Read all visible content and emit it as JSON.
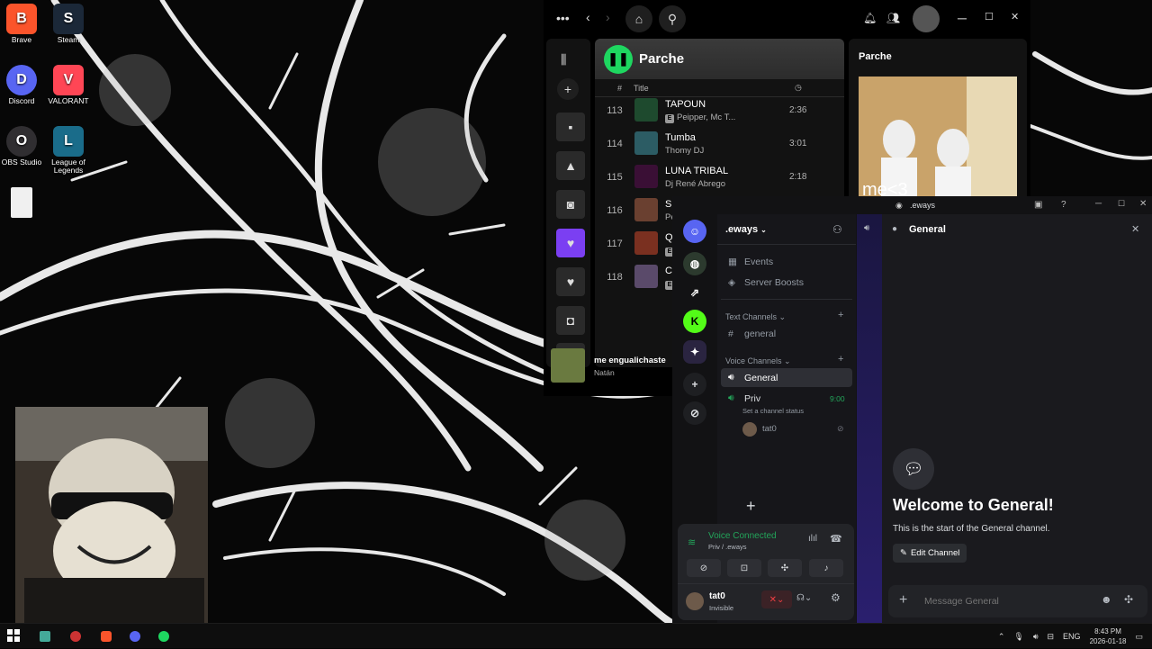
{
  "desktop": {
    "icons": [
      {
        "label": "Brave",
        "glyph": "B",
        "color": "#fb542b"
      },
      {
        "label": "Steam",
        "glyph": "S",
        "color": "#1b2838"
      },
      {
        "label": "Discord",
        "glyph": "D",
        "color": "#5865f2"
      },
      {
        "label": "VALORANT",
        "glyph": "V",
        "color": "#ff4655"
      },
      {
        "label": "OBS Studio",
        "glyph": "O",
        "color": "#302e31"
      },
      {
        "label": "League of Legends",
        "glyph": "L",
        "color": "#1a6c8a"
      }
    ]
  },
  "spotify": {
    "playlist_title": "Parche",
    "col_number": "#",
    "col_title": "Title",
    "tracks": [
      {
        "num": "113",
        "title": "TAPOUN",
        "artist": "Peipper, Mc T...",
        "duration": "2:36",
        "explicit": true,
        "color": "#1e4a2e"
      },
      {
        "num": "114",
        "title": "Tumba",
        "artist": "Thomy DJ",
        "duration": "3:01",
        "explicit": false,
        "color": "#2c5c64"
      },
      {
        "num": "115",
        "title": "LUNA TRIBAL",
        "artist": "Dj René Abrego",
        "duration": "2:18",
        "explicit": false,
        "color": "#3a0f35"
      },
      {
        "num": "116",
        "title": "Si",
        "artist": "Pe",
        "duration": "",
        "explicit": false,
        "color": "#6a4030"
      },
      {
        "num": "117",
        "title": "Q",
        "artist": "",
        "duration": "",
        "explicit": true,
        "color": "#7a3020"
      },
      {
        "num": "118",
        "title": "C",
        "artist": "",
        "duration": "",
        "explicit": true,
        "color": "#5a4a6a"
      }
    ],
    "right_panel_title": "Parche",
    "now_playing": {
      "title": "me engualichaste",
      "artist": "Natán"
    }
  },
  "discord": {
    "window_title": ".eways",
    "server_name": ".eways",
    "menu": [
      {
        "label": "Events",
        "icon": "calendar-icon"
      },
      {
        "label": "Server Boosts",
        "icon": "boost-icon"
      }
    ],
    "text_category": "Text Channels",
    "text_channels": [
      "general"
    ],
    "voice_category": "Voice Channels",
    "voice_channels": [
      {
        "name": "General",
        "active": true
      },
      {
        "name": "Priv",
        "time": "9:00",
        "status": "Set a channel status",
        "member": "tat0"
      }
    ],
    "chat_header": "General",
    "welcome_title": "Welcome to General!",
    "welcome_sub": "This is the start of the General channel.",
    "edit_channel": "Edit Channel",
    "message_placeholder": "Message General",
    "voice_connected": "Voice Connected",
    "voice_location": "Priv / .eways",
    "user": {
      "name": "tat0",
      "status": "Invisible"
    }
  },
  "taskbar": {
    "language": "ENG",
    "time": "8:43 PM",
    "date": "2026-01-18"
  }
}
